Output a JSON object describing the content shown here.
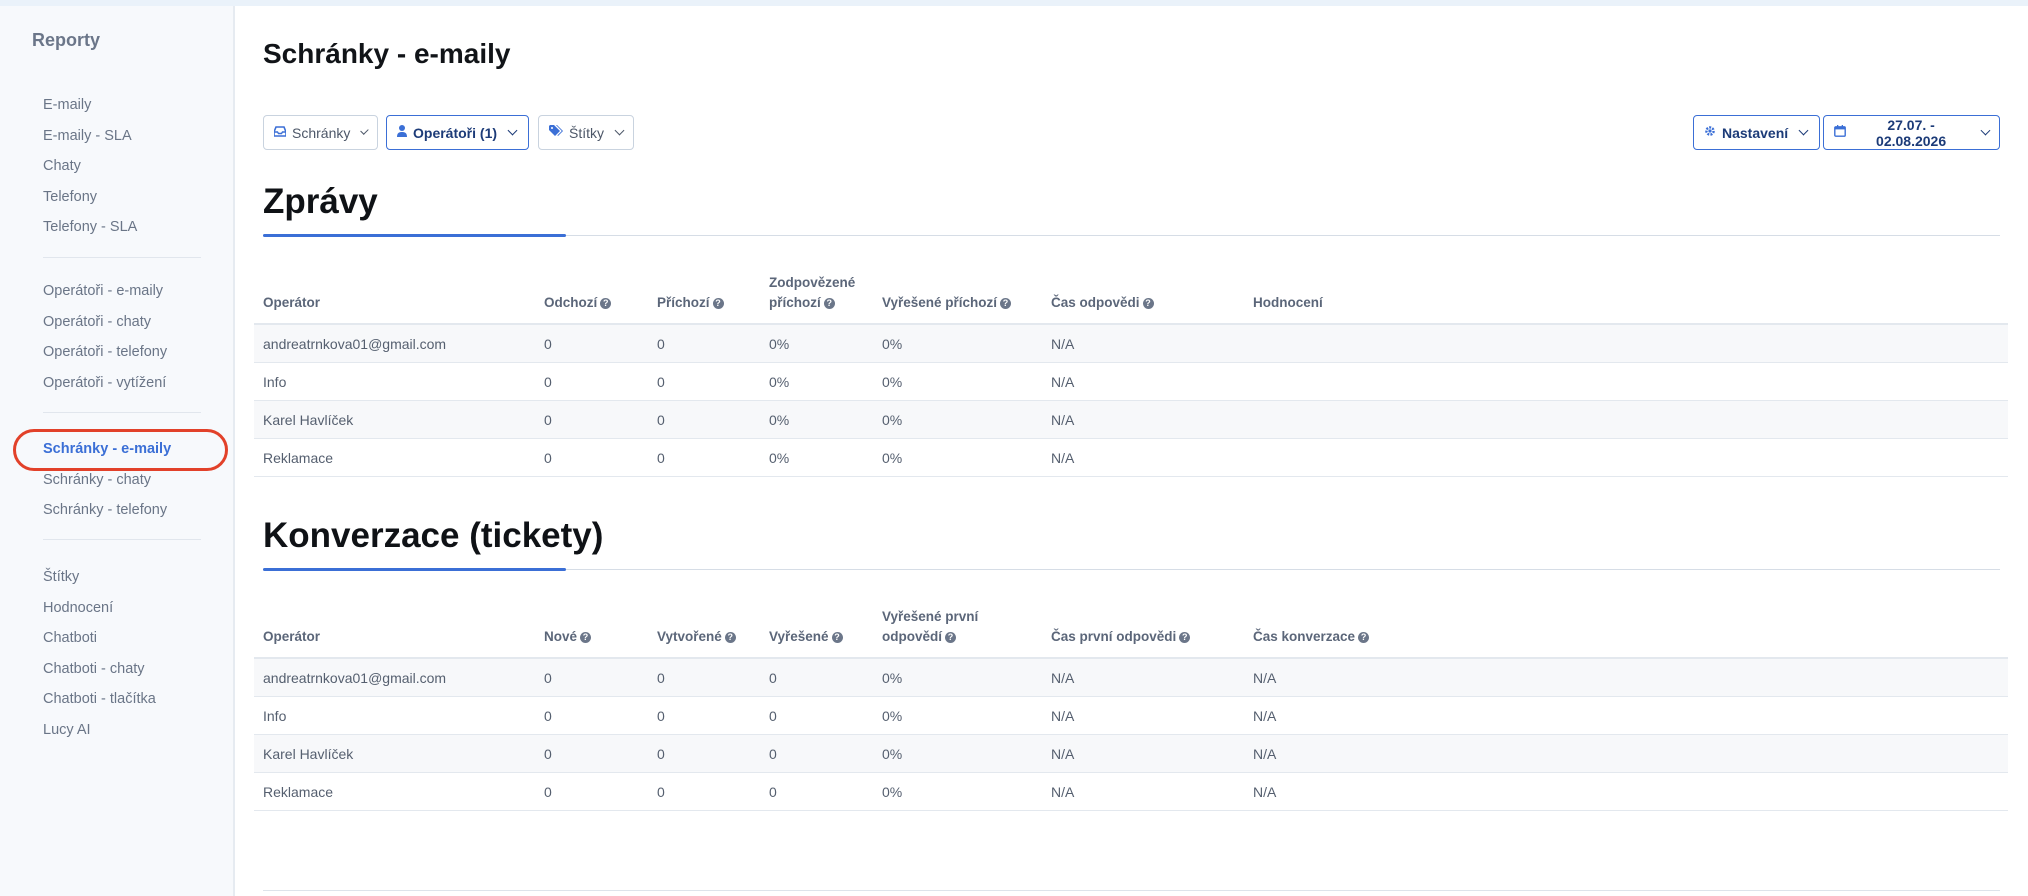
{
  "sidebar": {
    "title": "Reporty",
    "groups": [
      [
        "E-maily",
        "E-maily - SLA",
        "Chaty",
        "Telefony",
        "Telefony - SLA"
      ],
      [
        "Operátoři - e-maily",
        "Operátoři - chaty",
        "Operátoři - telefony",
        "Operátoři - vytížení"
      ],
      [
        "Schránky - e-maily",
        "Schránky - chaty",
        "Schránky - telefony"
      ],
      [
        "Štítky",
        "Hodnocení",
        "Chatboti",
        "Chatboti - chaty",
        "Chatboti - tlačítka",
        "Lucy AI"
      ]
    ],
    "active": "Schránky - e-maily"
  },
  "page": {
    "title": "Schránky - e-maily"
  },
  "filters": {
    "mailboxes": {
      "label": "Schránky",
      "icon": "inbox-icon"
    },
    "operators": {
      "label": "Operátoři (1)",
      "icon": "user-icon"
    },
    "tags": {
      "label": "Štítky",
      "icon": "tags-icon"
    },
    "settings": {
      "label": "Nastavení",
      "icon": "gear-icon"
    },
    "date_range": {
      "label": "27.07. - 02.08.2026",
      "icon": "calendar-icon"
    }
  },
  "messages": {
    "title": "Zprávy",
    "headers": [
      "Operátor",
      "Odchozí",
      "Příchozí",
      "Zodpovězené příchozí",
      "Vyřešené příchozí",
      "Čas odpovědi",
      "Hodnocení"
    ],
    "header_lines": [
      [
        "Operátor"
      ],
      [
        "Odchozí"
      ],
      [
        "Příchozí"
      ],
      [
        "Zodpovězené",
        "příchozí"
      ],
      [
        "Vyřešené příchozí"
      ],
      [
        "Čas odpovědi"
      ],
      [
        "Hodnocení"
      ]
    ],
    "help": [
      false,
      true,
      true,
      true,
      true,
      true,
      false
    ],
    "rows": [
      [
        "andreatrnkova01@gmail.com",
        "0",
        "0",
        "0%",
        "0%",
        "N/A",
        ""
      ],
      [
        "Info",
        "0",
        "0",
        "0%",
        "0%",
        "N/A",
        ""
      ],
      [
        "Karel Havlíček",
        "0",
        "0",
        "0%",
        "0%",
        "N/A",
        ""
      ],
      [
        "Reklamace",
        "0",
        "0",
        "0%",
        "0%",
        "N/A",
        ""
      ]
    ]
  },
  "conversations": {
    "title": "Konverzace (tickety)",
    "headers": [
      "Operátor",
      "Nové",
      "Vytvořené",
      "Vyřešené",
      "Vyřešené první odpovědí",
      "Čas první odpovědi",
      "Čas konverzace"
    ],
    "header_lines": [
      [
        "Operátor"
      ],
      [
        "Nové"
      ],
      [
        "Vytvořené"
      ],
      [
        "Vyřešené"
      ],
      [
        "Vyřešené první",
        "odpovědí"
      ],
      [
        "Čas první odpovědi"
      ],
      [
        "Čas konverzace"
      ]
    ],
    "help": [
      false,
      true,
      true,
      true,
      true,
      true,
      true
    ],
    "rows": [
      [
        "andreatrnkova01@gmail.com",
        "0",
        "0",
        "0",
        "0%",
        "N/A",
        "N/A"
      ],
      [
        "Info",
        "0",
        "0",
        "0",
        "0%",
        "N/A",
        "N/A"
      ],
      [
        "Karel Havlíček",
        "0",
        "0",
        "0",
        "0%",
        "N/A",
        "N/A"
      ],
      [
        "Reklamace",
        "0",
        "0",
        "0",
        "0%",
        "N/A",
        "N/A"
      ]
    ]
  },
  "colors": {
    "accent": "#3b6fd6",
    "highlight_ring": "#e2412a"
  }
}
